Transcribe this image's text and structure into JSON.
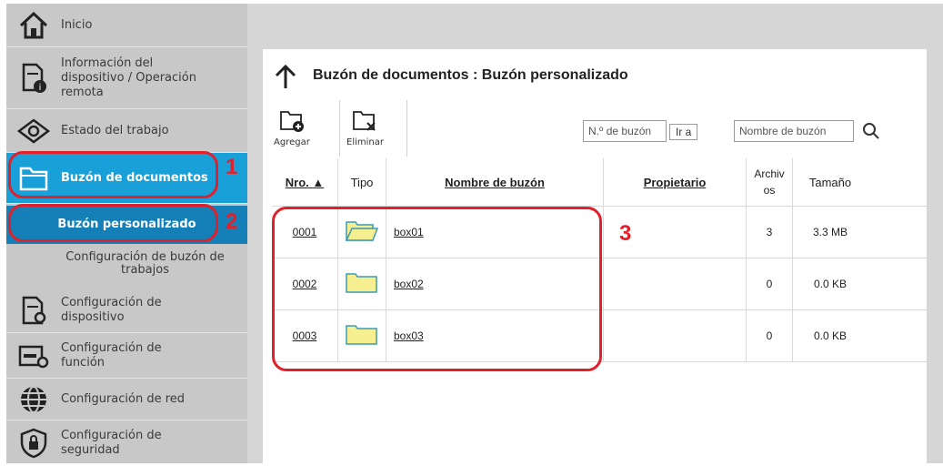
{
  "sidebar": {
    "items": [
      {
        "label": "Inicio",
        "icon": "home-icon"
      },
      {
        "label": "Información del dispositivo / Operación remota",
        "icon": "device-info-icon"
      },
      {
        "label": "Estado del trabajo",
        "icon": "eye-icon"
      },
      {
        "label": "Buzón de documentos",
        "icon": "folder-icon"
      },
      {
        "label": "Configuración de dispositivo",
        "icon": "device-settings-icon"
      },
      {
        "label": "Configuración de función",
        "icon": "function-settings-icon"
      },
      {
        "label": "Configuración de red",
        "icon": "globe-icon"
      },
      {
        "label": "Configuración de seguridad",
        "icon": "shield-icon"
      }
    ],
    "subitems": [
      {
        "label": "Buzón personalizado"
      },
      {
        "label": "Configuración de buzón de trabajos"
      }
    ]
  },
  "main": {
    "title": "Buzón de documentos : Buzón personalizado",
    "toolbar": {
      "add_label": "Agregar",
      "delete_label": "Eliminar"
    },
    "search": {
      "box_number_placeholder": "N.º de buzón",
      "go_label": "Ir a",
      "box_name_placeholder": "Nombre de buzón"
    },
    "table": {
      "headers": {
        "number": "Nro.",
        "type": "Tipo",
        "name": "Nombre de buzón",
        "owner": "Propietario",
        "files": "Archivos",
        "size": "Tamaño"
      },
      "rows": [
        {
          "number": "0001",
          "name": "box01",
          "owner": "",
          "files": "3",
          "size": "3.3 MB",
          "folder": "open"
        },
        {
          "number": "0002",
          "name": "box02",
          "owner": "",
          "files": "0",
          "size": "0.0 KB",
          "folder": "closed"
        },
        {
          "number": "0003",
          "name": "box03",
          "owner": "",
          "files": "0",
          "size": "0.0 KB",
          "folder": "closed"
        }
      ]
    }
  },
  "callouts": {
    "one": "1",
    "two": "2",
    "three": "3"
  },
  "colors": {
    "accent": "#1aa0d8",
    "accent_dark": "#1580b8",
    "callout": "#e0202a",
    "sidebar_bg": "#c8c8c8"
  }
}
